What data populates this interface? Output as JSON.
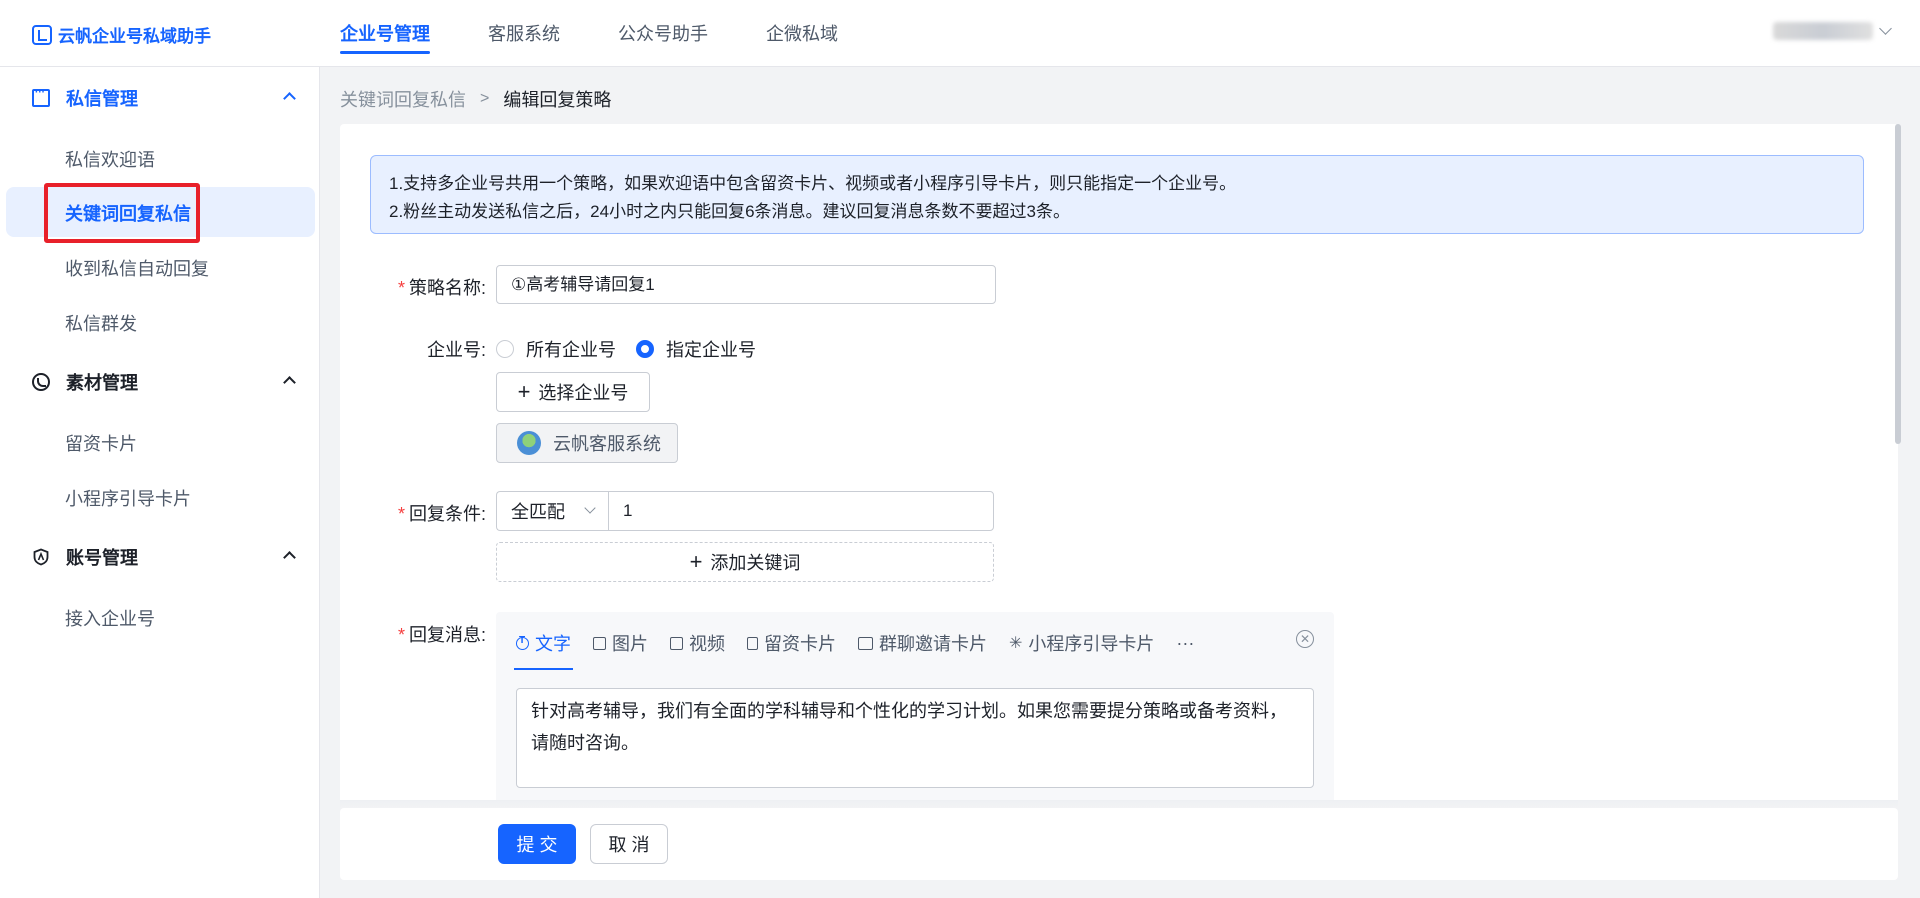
{
  "app": {
    "title": "云帆企业号私域助手"
  },
  "topnav": [
    {
      "label": "企业号管理",
      "active": true
    },
    {
      "label": "客服系统",
      "active": false
    },
    {
      "label": "公众号助手",
      "active": false
    },
    {
      "label": "企微私域",
      "active": false
    }
  ],
  "sidebar": {
    "groups": [
      {
        "label": "私信管理",
        "icon": "chat-icon",
        "items": [
          "私信欢迎语",
          "关键词回复私信",
          "收到私信自动回复",
          "私信群发"
        ]
      },
      {
        "label": "素材管理",
        "icon": "material-icon",
        "items": [
          "留资卡片",
          "小程序引导卡片"
        ]
      },
      {
        "label": "账号管理",
        "icon": "shield-icon",
        "items": [
          "接入企业号"
        ]
      }
    ],
    "active_item": "关键词回复私信"
  },
  "breadcrumb": {
    "parent": "关键词回复私信",
    "separator": ">",
    "current": "编辑回复策略"
  },
  "notice": {
    "line1": "1.支持多企业号共用一个策略，如果欢迎语中包含留资卡片、视频或者小程序引导卡片，则只能指定一个企业号。",
    "line2": "2.粉丝主动发送私信之后，24小时之内只能回复6条消息。建议回复消息条数不要超过3条。"
  },
  "form": {
    "strategy_name": {
      "label": "策略名称:",
      "value": "①高考辅导请回复1"
    },
    "account": {
      "label": "企业号:",
      "options": [
        "所有企业号",
        "指定企业号"
      ],
      "selected": "指定企业号",
      "select_button": "选择企业号",
      "selected_tag": "云帆客服系统"
    },
    "condition": {
      "label": "回复条件:",
      "match_type": "全匹配",
      "keyword": "1",
      "add_button": "添加关键词"
    },
    "reply": {
      "label": "回复消息:",
      "tabs": [
        "文字",
        "图片",
        "视频",
        "留资卡片",
        "群聊邀请卡片",
        "小程序引导卡片",
        "···"
      ],
      "active_tab": "文字",
      "content": "针对高考辅导，我们有全面的学科辅导和个性化的学习计划。如果您需要提分策略或备考资料，请随时咨询。"
    }
  },
  "footer": {
    "submit": "提 交",
    "cancel": "取 消"
  },
  "colors": {
    "accent": "#1664ff",
    "highlight": "#e8202a",
    "required": "#f53f3f"
  }
}
